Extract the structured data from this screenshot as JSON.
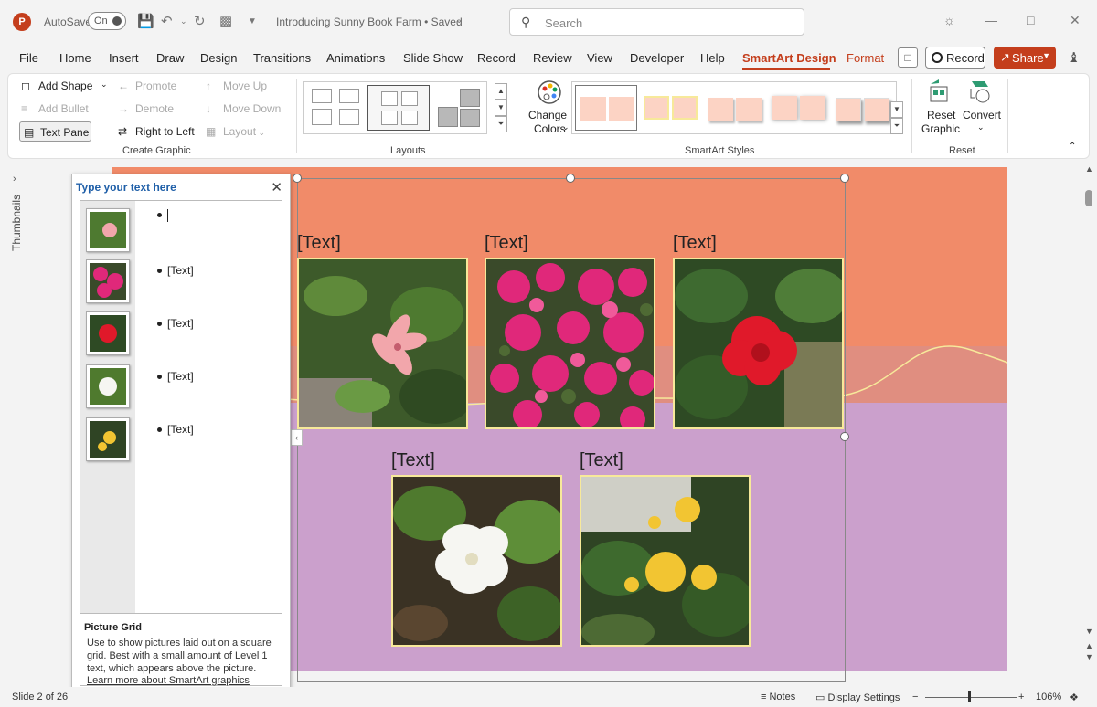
{
  "app": {
    "logo": "P",
    "autosave_label": "AutoSave",
    "autosave_state": "On",
    "doc_title": "Introducing Sunny Book Farm • Saved",
    "search_placeholder": "Search"
  },
  "tabs": [
    {
      "label": "File"
    },
    {
      "label": "Home"
    },
    {
      "label": "Insert"
    },
    {
      "label": "Draw"
    },
    {
      "label": "Design"
    },
    {
      "label": "Transitions"
    },
    {
      "label": "Animations"
    },
    {
      "label": "Slide Show"
    },
    {
      "label": "Record"
    },
    {
      "label": "Review"
    },
    {
      "label": "View"
    },
    {
      "label": "Developer"
    },
    {
      "label": "Help"
    },
    {
      "label": "SmartArt Design"
    },
    {
      "label": "Format"
    }
  ],
  "header_buttons": {
    "record": "Record",
    "share": "Share"
  },
  "ribbon": {
    "create_graphic": {
      "add_shape": "Add Shape",
      "add_bullet": "Add Bullet",
      "text_pane": "Text Pane",
      "promote": "Promote",
      "demote": "Demote",
      "right_to_left": "Right to Left",
      "move_up": "Move Up",
      "move_down": "Move Down",
      "layout": "Layout",
      "group_label": "Create Graphic"
    },
    "layouts": {
      "group_label": "Layouts"
    },
    "smartart_styles": {
      "change_colors_1": "Change",
      "change_colors_2": "Colors",
      "group_label": "SmartArt Styles"
    },
    "reset": {
      "reset_graphic_1": "Reset",
      "reset_graphic_2": "Graphic",
      "convert": "Convert",
      "group_label": "Reset"
    }
  },
  "thumbnails_label": "Thumbnails",
  "text_pane": {
    "title": "Type your text here",
    "bullets": [
      "",
      "[Text]",
      "[Text]",
      "[Text]",
      "[Text]"
    ],
    "desc_title": "Picture Grid",
    "desc_body": "Use to show pictures laid out on a square grid. Best with a small amount of Level 1 text, which appears above the picture.",
    "desc_link": "Learn more about SmartArt graphics"
  },
  "slide_items": [
    {
      "label": "[Text]",
      "photo": "pink azalea"
    },
    {
      "label": "[Text]",
      "photo": "magenta bougainvillea"
    },
    {
      "label": "[Text]",
      "photo": "red hibiscus"
    },
    {
      "label": "[Text]",
      "photo": "white gardenia"
    },
    {
      "label": "[Text]",
      "photo": "yellow ixora"
    }
  ],
  "status": {
    "slide": "Slide 2 of 26",
    "notes": "Notes",
    "display_settings": "Display Settings",
    "zoom": "106%"
  },
  "colors": {
    "accent": "#c43e1c",
    "band_top": "#f18b69",
    "band_mid": "#e08e80",
    "band_bottom": "#cba0cc",
    "photo_border": "#f7e99a"
  }
}
